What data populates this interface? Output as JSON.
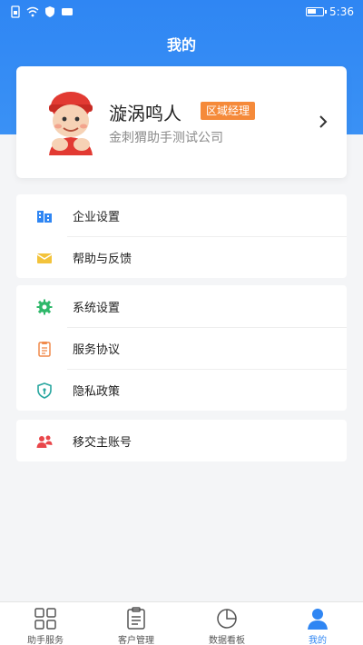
{
  "status_bar": {
    "time": "5:36"
  },
  "header": {
    "title": "我的"
  },
  "profile": {
    "name": "漩涡鸣人",
    "role": "区域经理",
    "company": "金刺猬助手测试公司"
  },
  "menu_groups": [
    {
      "items": [
        {
          "label": "企业设置",
          "icon": "building-icon"
        },
        {
          "label": "帮助与反馈",
          "icon": "envelope-icon"
        }
      ]
    },
    {
      "items": [
        {
          "label": "系统设置",
          "icon": "gear-icon"
        },
        {
          "label": "服务协议",
          "icon": "document-icon"
        },
        {
          "label": "隐私政策",
          "icon": "shield-icon"
        }
      ]
    },
    {
      "items": [
        {
          "label": "移交主账号",
          "icon": "users-transfer-icon"
        }
      ]
    }
  ],
  "tabbar": {
    "tabs": [
      {
        "label": "助手服务",
        "icon": "grid-icon",
        "active": false
      },
      {
        "label": "客户管理",
        "icon": "clipboard-icon",
        "active": false
      },
      {
        "label": "数据看板",
        "icon": "pie-chart-icon",
        "active": false
      },
      {
        "label": "我的",
        "icon": "user-icon",
        "active": true
      }
    ]
  },
  "colors": {
    "primary": "#2f86f3",
    "badge": "#f58a3a",
    "icon_blue": "#2f86f3",
    "icon_yellow": "#f3c33b",
    "icon_green": "#2fb86a",
    "icon_orange": "#f08a4b",
    "icon_teal": "#2aa7a0",
    "icon_red": "#e9464a"
  }
}
